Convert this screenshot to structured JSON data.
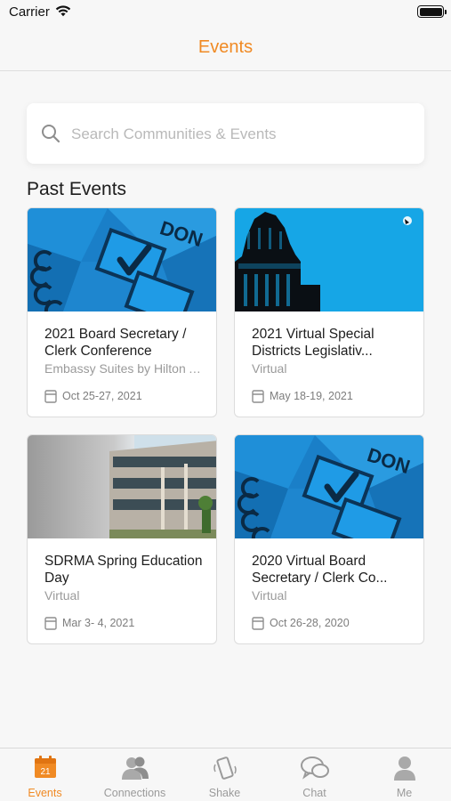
{
  "status_bar": {
    "carrier": "Carrier"
  },
  "nav": {
    "title": "Events"
  },
  "search": {
    "placeholder": "Search Communities & Events"
  },
  "section": {
    "title": "Past Events"
  },
  "events": [
    {
      "title": "2021 Board Secretary / Clerk Conference",
      "venue": "Embassy Suites by Hilton A...",
      "date": "Oct 25-27, 2021",
      "image": "checkbox-artwork"
    },
    {
      "title": "2021 Virtual Special Districts Legislativ...",
      "venue": "Virtual",
      "date": "May 18-19, 2021",
      "image": "capitol-dome"
    },
    {
      "title": "SDRMA Spring Education Day",
      "venue": "Virtual",
      "date": "Mar 3- 4, 2021",
      "image": "office-building"
    },
    {
      "title": "2020 Virtual Board Secretary / Clerk Co...",
      "venue": "Virtual",
      "date": "Oct 26-28, 2020",
      "image": "checkbox-artwork"
    }
  ],
  "tabs": [
    {
      "label": "Events",
      "icon": "calendar-icon",
      "badge": "21",
      "active": true
    },
    {
      "label": "Connections",
      "icon": "people-icon",
      "active": false
    },
    {
      "label": "Shake",
      "icon": "phone-shake-icon",
      "active": false
    },
    {
      "label": "Chat",
      "icon": "chat-bubbles-icon",
      "active": false
    },
    {
      "label": "Me",
      "icon": "person-icon",
      "active": false
    }
  ],
  "colors": {
    "accent": "#f08a24",
    "background": "#f7f7f7",
    "card": "#ffffff",
    "image_blue": "#1c8fd6",
    "sky_blue": "#14a3e4"
  }
}
